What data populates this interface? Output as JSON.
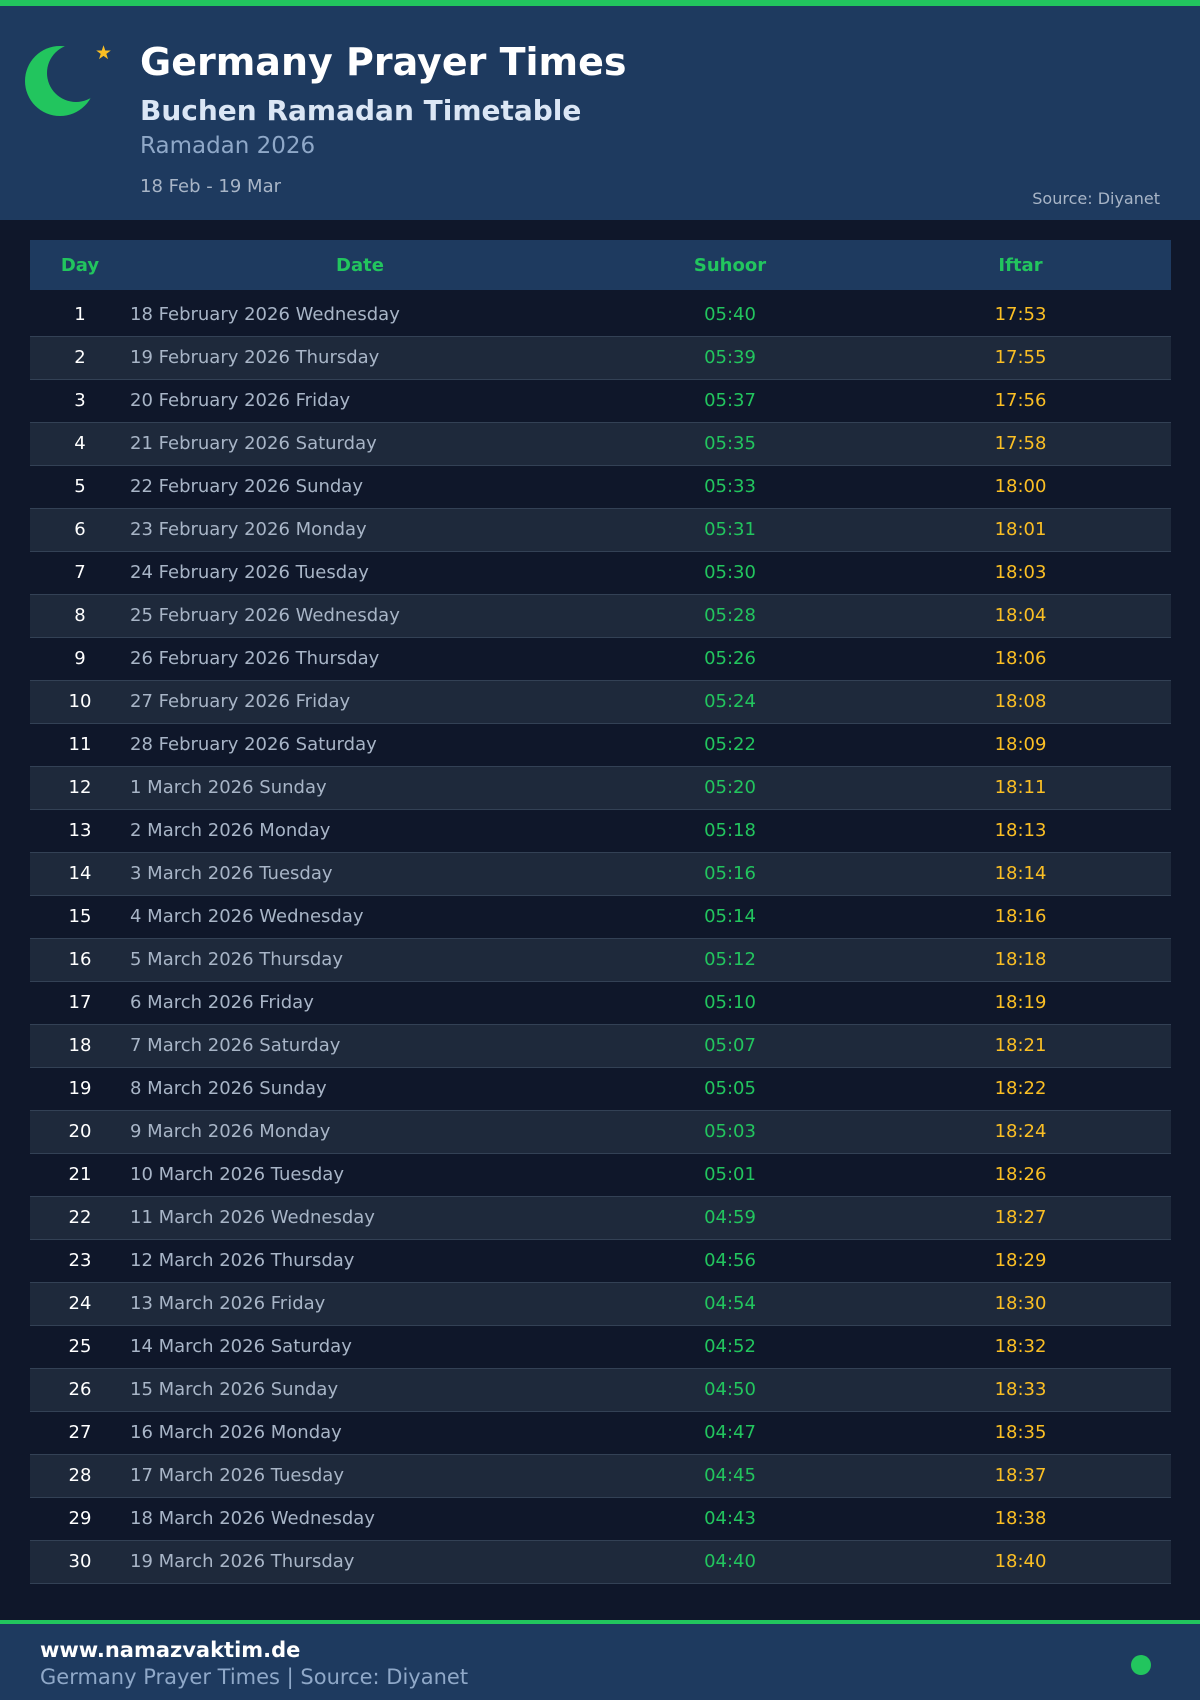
{
  "header": {
    "title": "Germany Prayer Times",
    "subtitle": "Buchen Ramadan Timetable",
    "season": "Ramadan 2026",
    "date_range": "18 Feb - 19 Mar",
    "source": "Source: Diyanet",
    "icons": [
      "crescent-moon-icon",
      "star-icon"
    ]
  },
  "table": {
    "headers": [
      "Day",
      "Date",
      "Suhoor",
      "Iftar"
    ],
    "rows": [
      [
        "1",
        "18 February 2026 Wednesday",
        "05:40",
        "17:53"
      ],
      [
        "2",
        "19 February 2026 Thursday",
        "05:39",
        "17:55"
      ],
      [
        "3",
        "20 February 2026 Friday",
        "05:37",
        "17:56"
      ],
      [
        "4",
        "21 February 2026 Saturday",
        "05:35",
        "17:58"
      ],
      [
        "5",
        "22 February 2026 Sunday",
        "05:33",
        "18:00"
      ],
      [
        "6",
        "23 February 2026 Monday",
        "05:31",
        "18:01"
      ],
      [
        "7",
        "24 February 2026 Tuesday",
        "05:30",
        "18:03"
      ],
      [
        "8",
        "25 February 2026 Wednesday",
        "05:28",
        "18:04"
      ],
      [
        "9",
        "26 February 2026 Thursday",
        "05:26",
        "18:06"
      ],
      [
        "10",
        "27 February 2026 Friday",
        "05:24",
        "18:08"
      ],
      [
        "11",
        "28 February 2026 Saturday",
        "05:22",
        "18:09"
      ],
      [
        "12",
        "1 March 2026 Sunday",
        "05:20",
        "18:11"
      ],
      [
        "13",
        "2 March 2026 Monday",
        "05:18",
        "18:13"
      ],
      [
        "14",
        "3 March 2026 Tuesday",
        "05:16",
        "18:14"
      ],
      [
        "15",
        "4 March 2026 Wednesday",
        "05:14",
        "18:16"
      ],
      [
        "16",
        "5 March 2026 Thursday",
        "05:12",
        "18:18"
      ],
      [
        "17",
        "6 March 2026 Friday",
        "05:10",
        "18:19"
      ],
      [
        "18",
        "7 March 2026 Saturday",
        "05:07",
        "18:21"
      ],
      [
        "19",
        "8 March 2026 Sunday",
        "05:05",
        "18:22"
      ],
      [
        "20",
        "9 March 2026 Monday",
        "05:03",
        "18:24"
      ],
      [
        "21",
        "10 March 2026 Tuesday",
        "05:01",
        "18:26"
      ],
      [
        "22",
        "11 March 2026 Wednesday",
        "04:59",
        "18:27"
      ],
      [
        "23",
        "12 March 2026 Thursday",
        "04:56",
        "18:29"
      ],
      [
        "24",
        "13 March 2026 Friday",
        "04:54",
        "18:30"
      ],
      [
        "25",
        "14 March 2026 Saturday",
        "04:52",
        "18:32"
      ],
      [
        "26",
        "15 March 2026 Sunday",
        "04:50",
        "18:33"
      ],
      [
        "27",
        "16 March 2026 Monday",
        "04:47",
        "18:35"
      ],
      [
        "28",
        "17 March 2026 Tuesday",
        "04:45",
        "18:37"
      ],
      [
        "29",
        "18 March 2026 Wednesday",
        "04:43",
        "18:38"
      ],
      [
        "30",
        "19 March 2026 Thursday",
        "04:40",
        "18:40"
      ]
    ]
  },
  "footer": {
    "website": "www.namazvaktim.de",
    "caption": "Germany Prayer Times | Source: Diyanet"
  },
  "colors": {
    "accent_green": "#22c55e",
    "iftar_gold": "#fbbf24",
    "header_bg": "#1e3a5f",
    "page_bg": "#0f172a"
  }
}
